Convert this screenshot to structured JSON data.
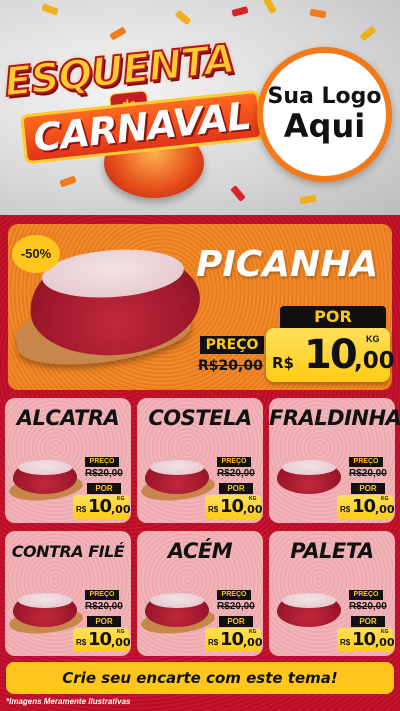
{
  "header": {
    "title_top": "Esquenta",
    "title_mid": "de",
    "title_bottom": "Carnaval",
    "logo_line1": "Sua Logo",
    "logo_line2": "Aqui"
  },
  "featured": {
    "discount": "-50%",
    "name": "PICANHA",
    "preco_label": "PREÇO",
    "old_price": "R$20,00",
    "por_label": "POR",
    "currency": "R$",
    "price_int": "10",
    "price_dec": ",00",
    "unit": "KG"
  },
  "products": [
    {
      "name": "ALCATRA",
      "preco_label": "PREÇO",
      "old_price": "R$20,00",
      "por_label": "POR",
      "currency": "R$",
      "price_int": "10",
      "price_dec": ",00",
      "unit": "KG"
    },
    {
      "name": "COSTELA",
      "preco_label": "PREÇO",
      "old_price": "R$20,00",
      "por_label": "POR",
      "currency": "R$",
      "price_int": "10",
      "price_dec": ",00",
      "unit": "KG"
    },
    {
      "name": "FRALDINHA",
      "preco_label": "PREÇO",
      "old_price": "R$20,00",
      "por_label": "POR",
      "currency": "R$",
      "price_int": "10",
      "price_dec": ",00",
      "unit": "KG"
    },
    {
      "name": "CONTRA FILÉ",
      "preco_label": "PREÇO",
      "old_price": "R$20,00",
      "por_label": "POR",
      "currency": "R$",
      "price_int": "10",
      "price_dec": ",00",
      "unit": "KG"
    },
    {
      "name": "ACÉM",
      "preco_label": "PREÇO",
      "old_price": "R$20,00",
      "por_label": "POR",
      "currency": "R$",
      "price_int": "10",
      "price_dec": ",00",
      "unit": "KG"
    },
    {
      "name": "PALETA",
      "preco_label": "PREÇO",
      "old_price": "R$20,00",
      "por_label": "POR",
      "currency": "R$",
      "price_int": "10",
      "price_dec": ",00",
      "unit": "KG"
    }
  ],
  "footer": {
    "cta": "Crie seu encarte com este tema!",
    "disclaimer": "*Imagens Meramente Ilustrativas"
  },
  "colors": {
    "background_red": "#b0112a",
    "featured_orange": "#e87a1e",
    "card_pink": "#ecaab0",
    "price_yellow": "#ffcc16",
    "label_black": "#111111"
  }
}
